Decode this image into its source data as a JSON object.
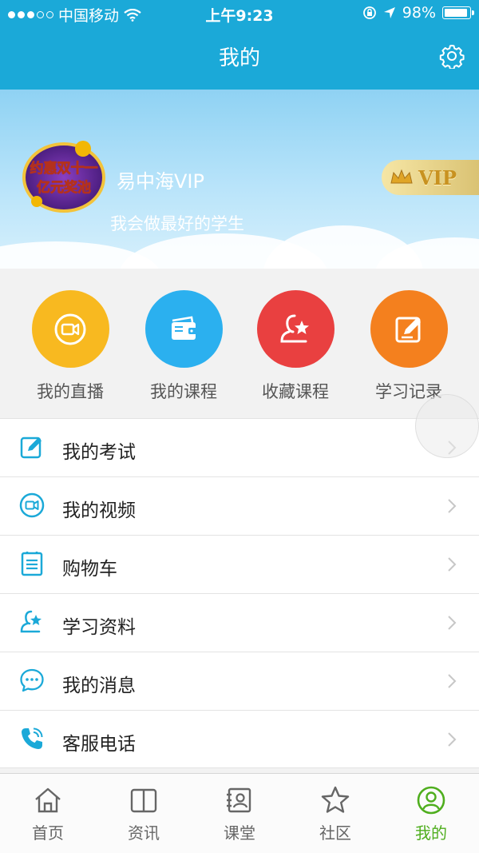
{
  "status_bar": {
    "carrier": "中国移动",
    "time": "上午9:23",
    "battery": "98%",
    "battery_level": 0.98
  },
  "header": {
    "title": "我的",
    "settings_icon": "gear-icon"
  },
  "profile": {
    "avatar_text": "约惠双十一 亿元奖池",
    "name": "易中海VIP",
    "motto": "我会做最好的学生",
    "vip_badge": "VIP"
  },
  "quick_actions": [
    {
      "label": "我的直播",
      "icon": "video-camera-icon",
      "color": "#f8b920"
    },
    {
      "label": "我的课程",
      "icon": "wallet-icon",
      "color": "#2bb0ef"
    },
    {
      "label": "收藏课程",
      "icon": "star-person-icon",
      "color": "#e94040"
    },
    {
      "label": "学习记录",
      "icon": "edit-icon",
      "color": "#f4801e"
    }
  ],
  "menu": [
    {
      "label": "我的考试",
      "icon": "edit-icon"
    },
    {
      "label": "我的视频",
      "icon": "video-camera-icon"
    },
    {
      "label": "购物车",
      "icon": "list-icon"
    },
    {
      "label": "学习资料",
      "icon": "star-person-icon"
    },
    {
      "label": "我的消息",
      "icon": "chat-bubble-icon"
    },
    {
      "label": "客服电话",
      "icon": "phone-icon"
    }
  ],
  "tabs": [
    {
      "label": "首页",
      "icon": "home-icon"
    },
    {
      "label": "资讯",
      "icon": "book-icon"
    },
    {
      "label": "课堂",
      "icon": "classroom-icon"
    },
    {
      "label": "社区",
      "icon": "star-icon"
    },
    {
      "label": "我的",
      "icon": "user-circle-icon",
      "active": true
    }
  ],
  "colors": {
    "header": "#1ba9d8",
    "accent_icon": "#1ba9d8",
    "tab_active": "#4fae1e"
  }
}
